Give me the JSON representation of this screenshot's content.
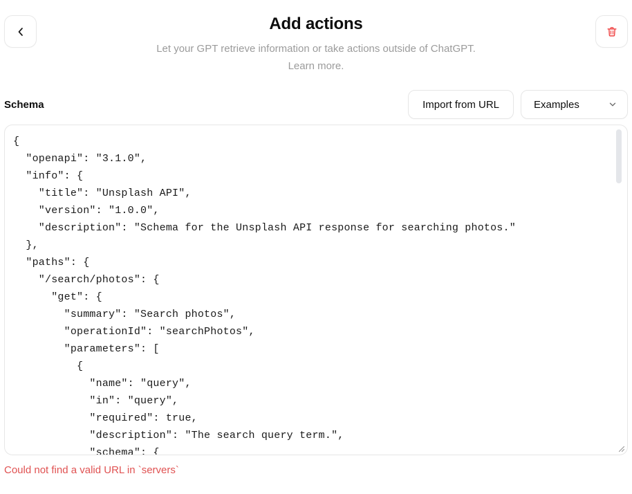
{
  "header": {
    "title": "Add actions",
    "subtitle": "Let your GPT retrieve information or take actions outside of ChatGPT.",
    "learn_more": "Learn more.",
    "back_icon": "chevron-left-icon",
    "delete_icon": "trash-icon"
  },
  "schema": {
    "label": "Schema",
    "import_button": "Import from URL",
    "examples_select": "Examples",
    "examples_chevron": "chevron-down-icon",
    "editor_value": "{\n  \"openapi\": \"3.1.0\",\n  \"info\": {\n    \"title\": \"Unsplash API\",\n    \"version\": \"1.0.0\",\n    \"description\": \"Schema for the Unsplash API response for searching photos.\"\n  },\n  \"paths\": {\n    \"/search/photos\": {\n      \"get\": {\n        \"summary\": \"Search photos\",\n        \"operationId\": \"searchPhotos\",\n        \"parameters\": [\n          {\n            \"name\": \"query\",\n            \"in\": \"query\",\n            \"required\": true,\n            \"description\": \"The search query term.\",\n            \"schema\": {"
  },
  "error": {
    "message": "Could not find a valid URL in `servers`"
  },
  "colors": {
    "accent_danger": "#e05252",
    "delete_icon": "#ef4444",
    "border": "#e6e6e6",
    "muted_text": "#9b9b9b",
    "scrollbar_thumb": "#e4e6ea"
  }
}
